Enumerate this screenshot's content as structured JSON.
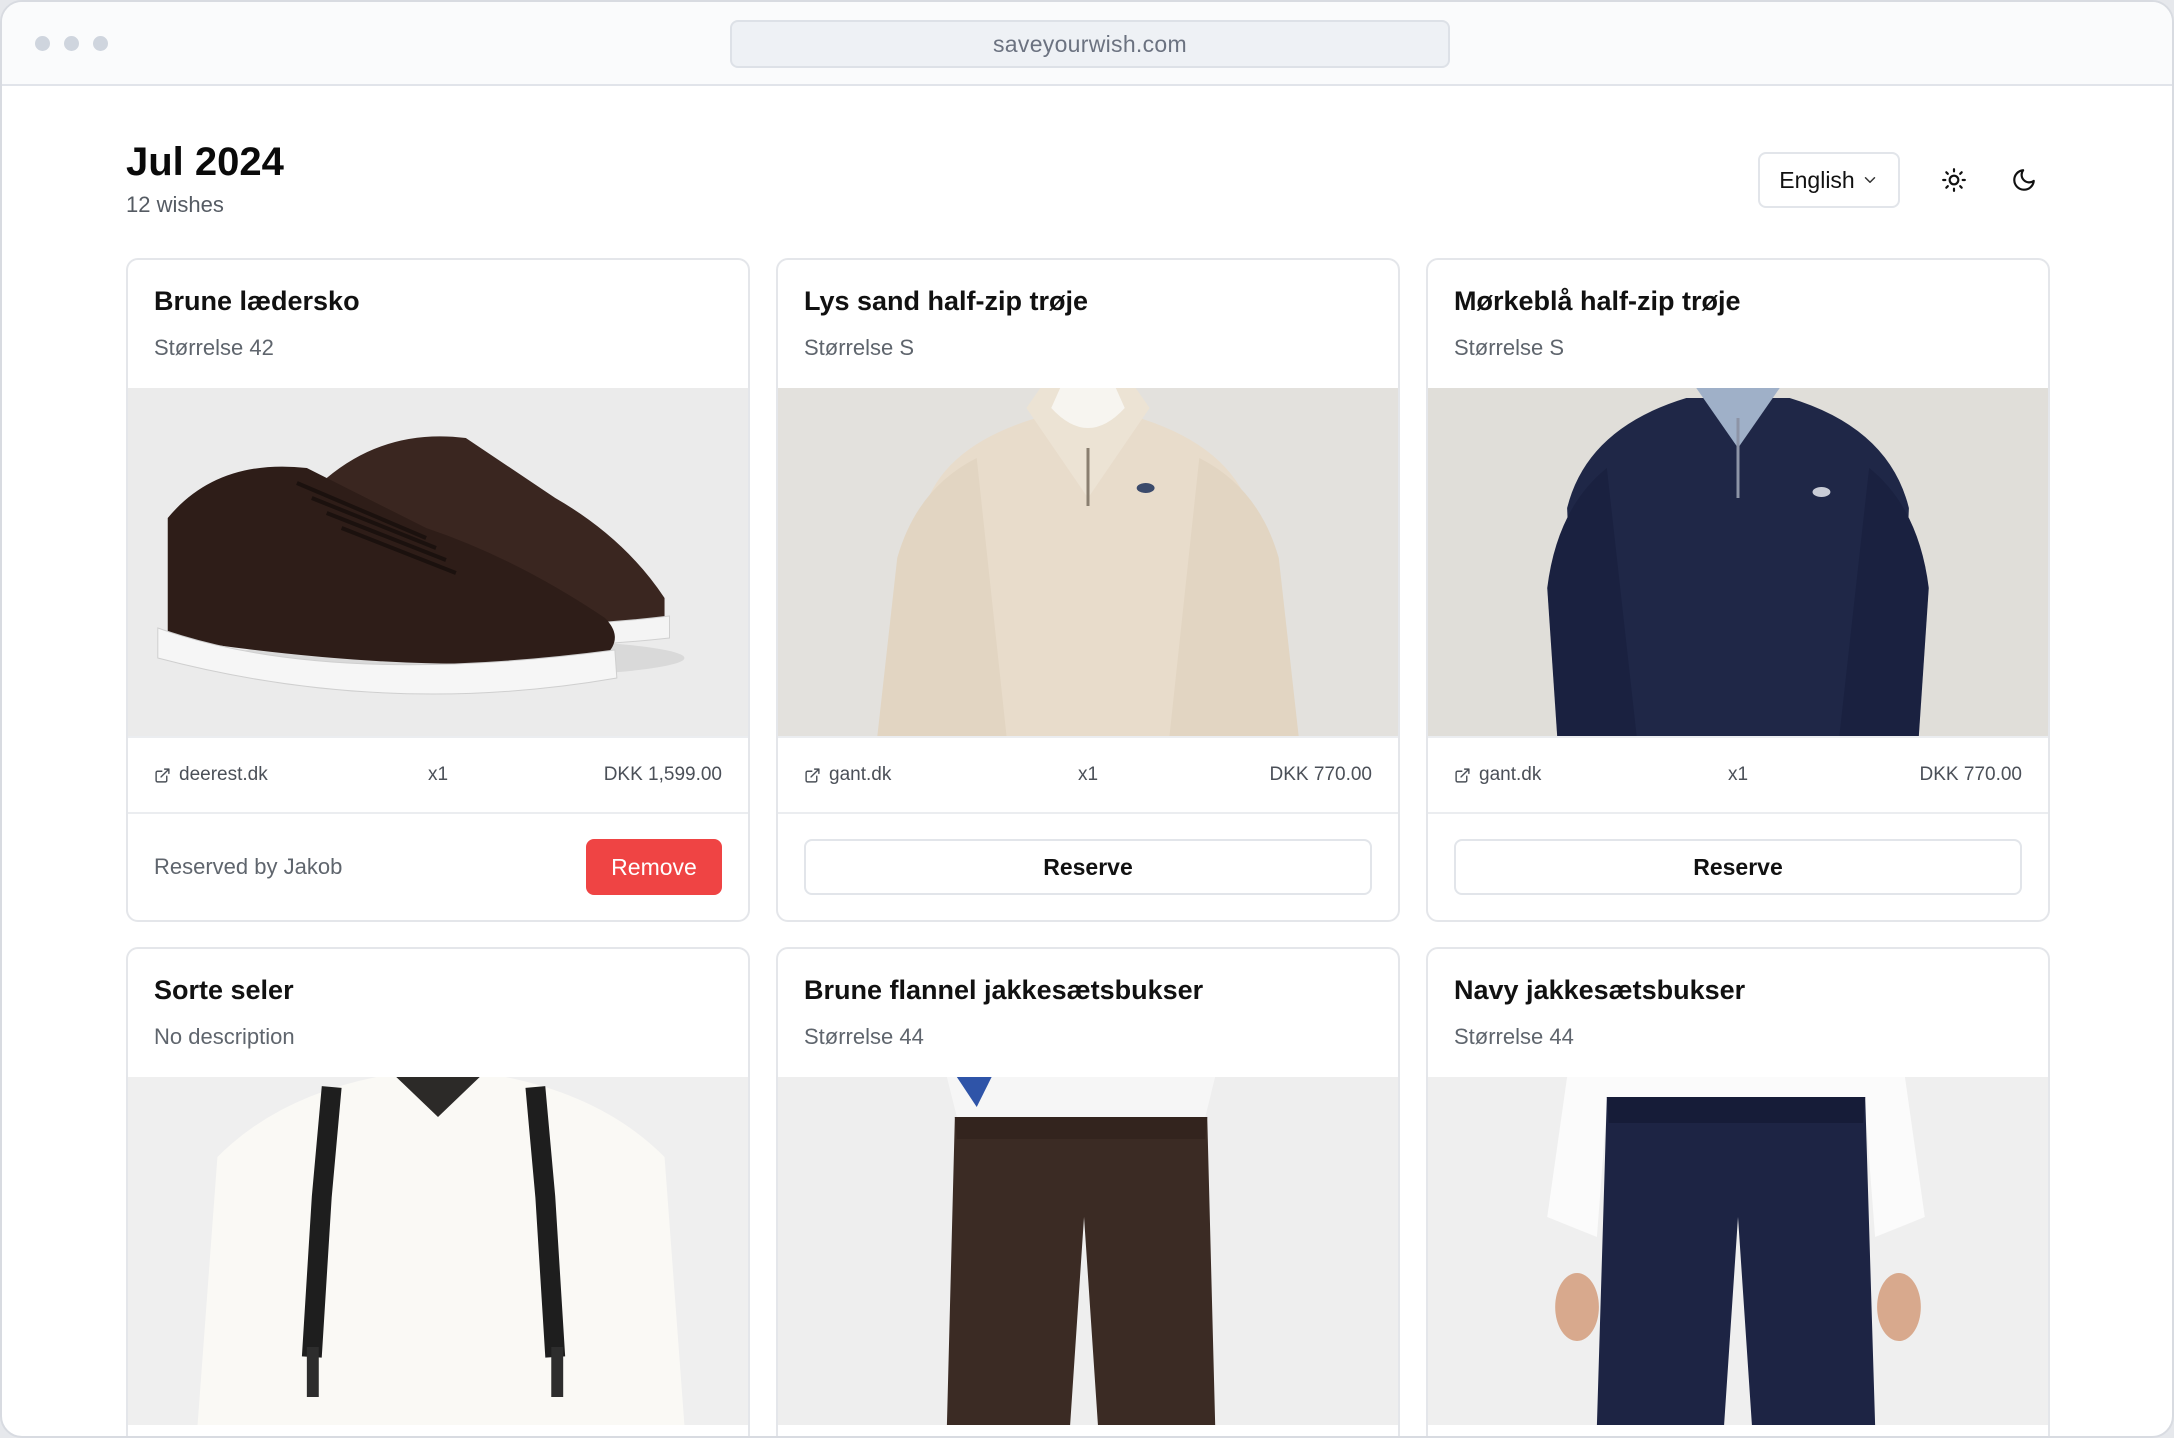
{
  "browser": {
    "url": "saveyourwish.com"
  },
  "header": {
    "title": "Jul 2024",
    "subtitle": "12 wishes",
    "language": "English"
  },
  "icons": {
    "theme_light": "sun-icon",
    "theme_dark": "moon-icon",
    "external": "external-link-icon",
    "chevron": "chevron-down-icon"
  },
  "colors": {
    "accent_danger": "#ef4444"
  },
  "wishes": [
    {
      "title": "Brune lædersko",
      "description": "Størrelse 42",
      "image": "brown leather sneakers",
      "store": "deerest.dk",
      "quantity": "x1",
      "price": "DKK 1,599.00",
      "reserved_text": "Reserved by Jakob",
      "action": "Remove"
    },
    {
      "title": "Lys sand half-zip trøje",
      "description": "Størrelse S",
      "image": "sand half-zip sweater",
      "store": "gant.dk",
      "quantity": "x1",
      "price": "DKK 770.00",
      "action": "Reserve"
    },
    {
      "title": "Mørkeblå half-zip trøje",
      "description": "Størrelse S",
      "image": "navy half-zip sweater",
      "store": "gant.dk",
      "quantity": "x1",
      "price": "DKK 770.00",
      "action": "Reserve"
    },
    {
      "title": "Sorte seler",
      "description": "No description",
      "image": "black suspenders"
    },
    {
      "title": "Brune flannel jakkesætsbukser",
      "description": "Størrelse 44",
      "image": "brown flannel trousers"
    },
    {
      "title": "Navy jakkesætsbukser",
      "description": "Størrelse 44",
      "image": "navy suit trousers"
    }
  ]
}
